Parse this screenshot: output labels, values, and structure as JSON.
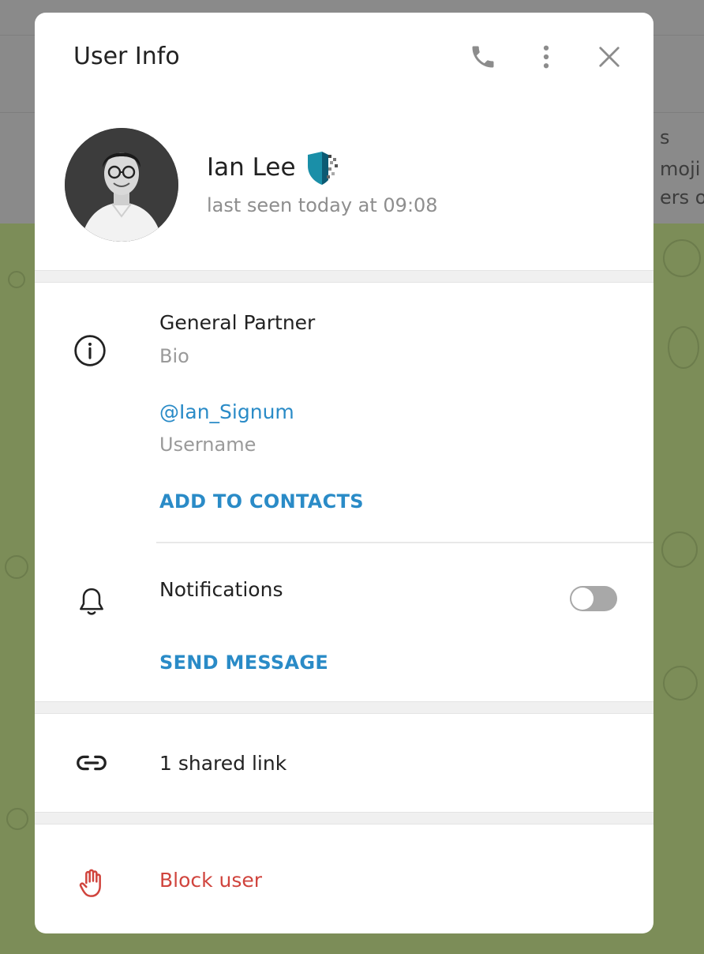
{
  "background": {
    "snippet_lines": [
      "s",
      "moji s",
      "ers of"
    ]
  },
  "modal": {
    "title": "User Info",
    "header_icons": [
      "phone-icon",
      "more-vertical-icon",
      "close-icon"
    ]
  },
  "profile": {
    "name": "Ian Lee",
    "status": "last seen today at 09:08",
    "badge_colors": {
      "shield": "#1a8fa8",
      "shield_dark": "#0c5a73"
    }
  },
  "info": {
    "bio_value": "General Partner",
    "bio_label": "Bio",
    "username_value": "@Ian_Signum",
    "username_label": "Username",
    "add_contacts": "ADD TO CONTACTS",
    "notifications_label": "Notifications",
    "notifications_enabled": false,
    "send_message": "SEND MESSAGE"
  },
  "shared": {
    "label": "1 shared link"
  },
  "block": {
    "label": "Block user"
  },
  "colors": {
    "accent": "#2a8bc7",
    "danger": "#d0443d",
    "muted": "#9a9a9a"
  }
}
